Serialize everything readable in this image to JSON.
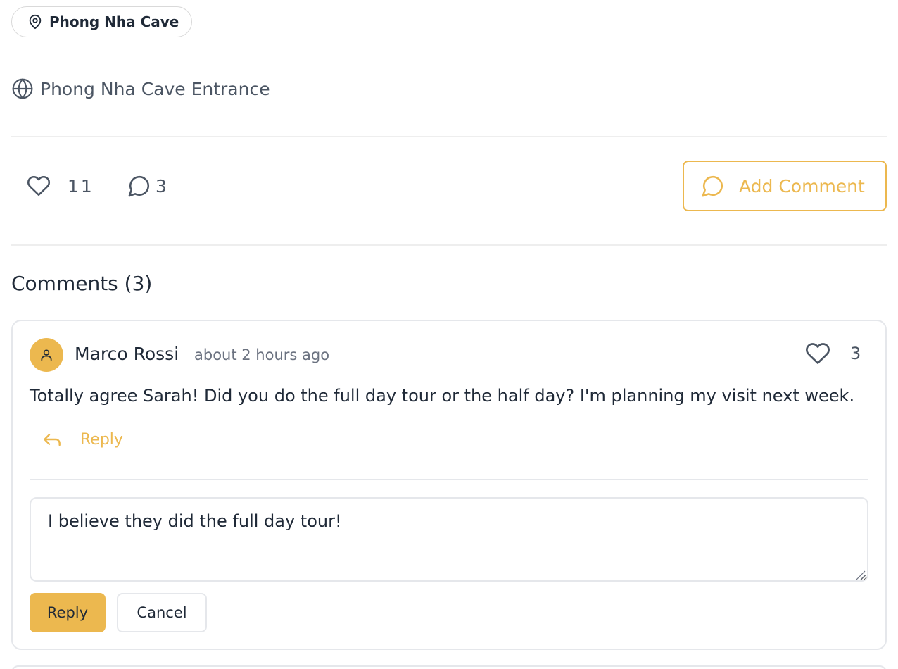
{
  "location_chip": {
    "label": "Phong Nha Cave",
    "icon": "map-pin-icon"
  },
  "place": {
    "label": "Phong Nha Cave Entrance",
    "icon": "globe-icon"
  },
  "stats": {
    "likes": "11",
    "comments": "3",
    "add_comment_label": "Add Comment"
  },
  "comments_section": {
    "title": "Comments (3)",
    "items": [
      {
        "author": "Marco Rossi",
        "time": "about 2 hours ago",
        "likes": "3",
        "text": "Totally agree Sarah! Did you do the full day tour or the half day? I'm planning my visit next week.",
        "reply_label": "Reply"
      }
    ]
  },
  "reply_form": {
    "value": "I believe they did the full day tour!",
    "submit_label": "Reply",
    "cancel_label": "Cancel"
  },
  "colors": {
    "accent": "#ecb84f",
    "border": "#e5e7eb",
    "muted": "#6b7280"
  }
}
